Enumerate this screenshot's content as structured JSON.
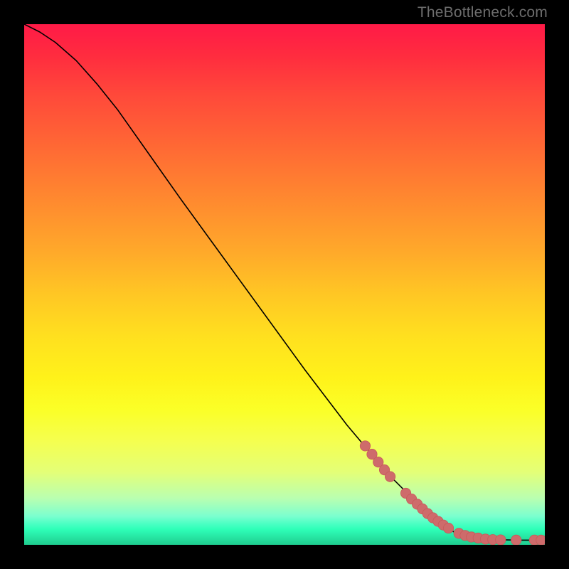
{
  "watermark": "TheBottleneck.com",
  "colors": {
    "curve": "#000000",
    "marker_fill": "#ce6b6b",
    "marker_stroke": "#c75a5a",
    "background": "#000000"
  },
  "chart_data": {
    "type": "line",
    "title": "",
    "xlabel": "",
    "ylabel": "",
    "xlim": [
      0,
      100
    ],
    "ylim": [
      0,
      100
    ],
    "grid": false,
    "curve_points": [
      {
        "x": 0.0,
        "y": 100.0
      },
      {
        "x": 3.0,
        "y": 98.5
      },
      {
        "x": 6.0,
        "y": 96.5
      },
      {
        "x": 10.0,
        "y": 93.0
      },
      {
        "x": 14.0,
        "y": 88.5
      },
      {
        "x": 18.0,
        "y": 83.5
      },
      {
        "x": 24.0,
        "y": 75.0
      },
      {
        "x": 30.0,
        "y": 66.5
      },
      {
        "x": 38.0,
        "y": 55.5
      },
      {
        "x": 46.0,
        "y": 44.5
      },
      {
        "x": 54.0,
        "y": 33.5
      },
      {
        "x": 62.0,
        "y": 23.0
      },
      {
        "x": 70.0,
        "y": 13.5
      },
      {
        "x": 76.0,
        "y": 7.5
      },
      {
        "x": 80.0,
        "y": 4.0
      },
      {
        "x": 83.0,
        "y": 2.2
      },
      {
        "x": 86.0,
        "y": 1.4
      },
      {
        "x": 90.0,
        "y": 1.0
      },
      {
        "x": 95.0,
        "y": 0.9
      },
      {
        "x": 100.0,
        "y": 0.9
      }
    ],
    "markers": [
      {
        "x": 65.5,
        "y": 19.0
      },
      {
        "x": 66.8,
        "y": 17.4
      },
      {
        "x": 68.0,
        "y": 15.9
      },
      {
        "x": 69.2,
        "y": 14.4
      },
      {
        "x": 70.3,
        "y": 13.1
      },
      {
        "x": 73.3,
        "y": 9.9
      },
      {
        "x": 74.4,
        "y": 8.8
      },
      {
        "x": 75.5,
        "y": 7.8
      },
      {
        "x": 76.5,
        "y": 6.9
      },
      {
        "x": 77.5,
        "y": 6.0
      },
      {
        "x": 78.5,
        "y": 5.2
      },
      {
        "x": 79.5,
        "y": 4.5
      },
      {
        "x": 80.5,
        "y": 3.8
      },
      {
        "x": 81.5,
        "y": 3.2
      },
      {
        "x": 83.5,
        "y": 2.2
      },
      {
        "x": 84.7,
        "y": 1.8
      },
      {
        "x": 85.9,
        "y": 1.5
      },
      {
        "x": 87.2,
        "y": 1.3
      },
      {
        "x": 88.6,
        "y": 1.1
      },
      {
        "x": 90.0,
        "y": 1.0
      },
      {
        "x": 91.5,
        "y": 0.95
      },
      {
        "x": 94.5,
        "y": 0.9
      },
      {
        "x": 98.0,
        "y": 0.9
      },
      {
        "x": 99.3,
        "y": 0.9
      }
    ]
  }
}
